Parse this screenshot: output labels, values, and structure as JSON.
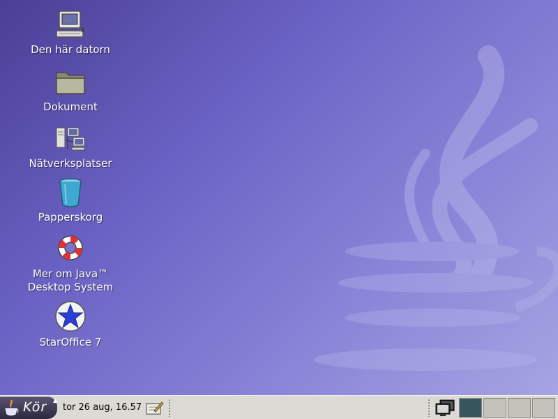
{
  "desktop": {
    "icons": [
      {
        "label": "Den här datorn",
        "icon": "computer-icon"
      },
      {
        "label": "Dokument",
        "icon": "folder-icon"
      },
      {
        "label": "Nätverksplatser",
        "icon": "network-places-icon"
      },
      {
        "label": "Papperskorg",
        "icon": "trash-icon"
      },
      {
        "label": "Mer om Java™\nDesktop System",
        "icon": "lifebuoy-icon"
      },
      {
        "label": "StarOffice 7",
        "icon": "staroffice-icon"
      }
    ]
  },
  "taskbar": {
    "start_label": "Kör",
    "clock": "tor 26 aug, 16.57",
    "workspaces": [
      {
        "active": true
      },
      {
        "active": false
      },
      {
        "active": false
      },
      {
        "active": false
      }
    ]
  },
  "colors": {
    "desktop_bg": "#6a62c4",
    "taskbar_bg": "#dcdad5",
    "workspace_active": "#36555d"
  }
}
